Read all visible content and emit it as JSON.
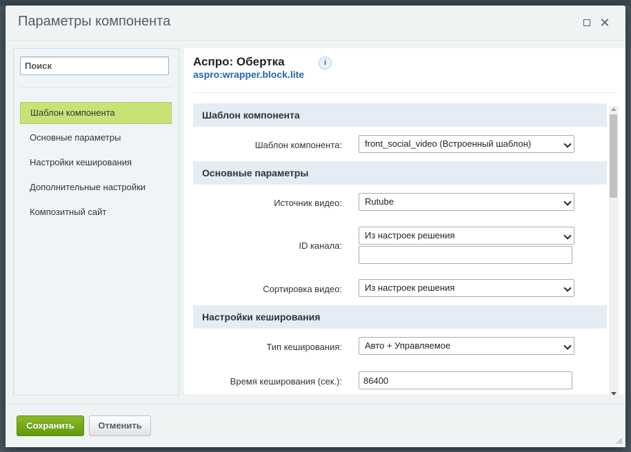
{
  "dialog": {
    "title": "Параметры компонента"
  },
  "sidebar": {
    "search_placeholder": "Поиск",
    "items": [
      {
        "label": "Шаблон компонента",
        "active": true
      },
      {
        "label": "Основные параметры",
        "active": false
      },
      {
        "label": "Настройки кеширования",
        "active": false
      },
      {
        "label": "Дополнительные настройки",
        "active": false
      },
      {
        "label": "Композитный сайт",
        "active": false
      }
    ]
  },
  "component": {
    "title": "Аспро: Обертка",
    "code": "aspro:wrapper.block.lite",
    "info_icon": "i"
  },
  "sections": {
    "template": {
      "heading": "Шаблон компонента",
      "template_label": "Шаблон компонента:",
      "template_value": "front_social_video (Встроенный шаблон)"
    },
    "main": {
      "heading": "Основные параметры",
      "source_label": "Источник видео:",
      "source_value": "Rutube",
      "channel_label": "ID канала:",
      "channel_select_value": "Из настроек решения",
      "channel_input_value": "",
      "sort_label": "Сортировка видео:",
      "sort_value": "Из настроек решения"
    },
    "cache": {
      "heading": "Настройки кеширования",
      "type_label": "Тип кеширования:",
      "type_value": "Авто + Управляемое",
      "time_label": "Время кеширования (сек.):",
      "time_value": "86400"
    }
  },
  "footer": {
    "save_label": "Сохранить",
    "cancel_label": "Отменить"
  },
  "colors": {
    "active_nav": "#c6e476",
    "section_bg": "#e4edf5",
    "link": "#2067b0",
    "save_button": "#6ea814"
  }
}
